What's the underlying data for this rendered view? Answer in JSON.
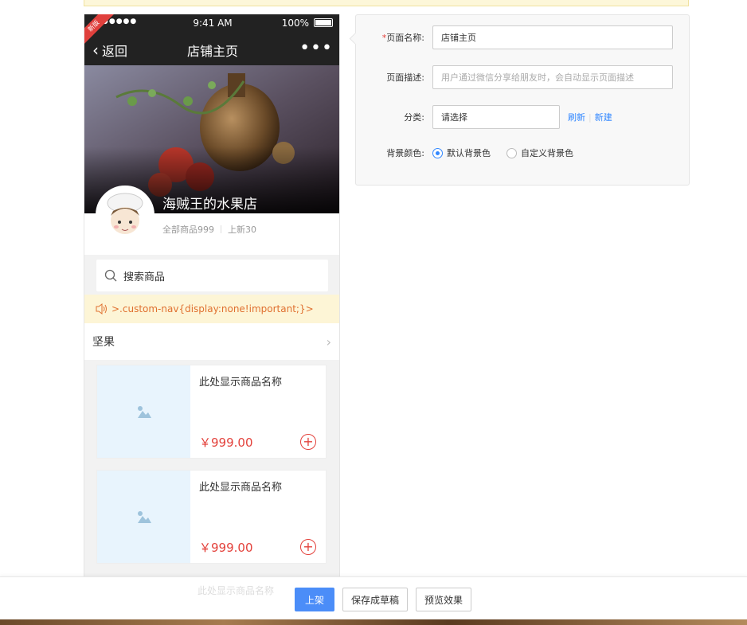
{
  "phone": {
    "status": {
      "time": "9:41 AM",
      "battery": "100%"
    },
    "ribbon": "新版",
    "nav": {
      "back": "返回",
      "title": "店铺主页",
      "more": "•••"
    },
    "shop": {
      "name": "海贼王的水果店",
      "all_goods": "全部商品999",
      "new_goods": "上新30"
    },
    "search": {
      "placeholder": "搜索商品"
    },
    "notice": ">.custom-nav{display:none!important;}>",
    "category": {
      "label": "坚果"
    },
    "products": [
      {
        "name": "此处显示商品名称",
        "price": "￥999.00"
      },
      {
        "name": "此处显示商品名称",
        "price": "￥999.00"
      }
    ]
  },
  "form": {
    "page_name": {
      "label": "页面名称:",
      "value": "店铺主页"
    },
    "page_desc": {
      "label": "页面描述:",
      "placeholder": "用户通过微信分享给朋友时，会自动显示页面描述"
    },
    "category": {
      "label": "分类:",
      "value": "请选择",
      "refresh": "刷新",
      "create": "新建"
    },
    "bg_color": {
      "label": "背景颜色:",
      "option_default": "默认背景色",
      "option_custom": "自定义背景色",
      "selected": "默认背景色"
    }
  },
  "actions": {
    "ghost_text": "此处显示商品名称",
    "publish": "上架",
    "save_draft": "保存成草稿",
    "preview": "预览效果"
  },
  "colors": {
    "accent": "#4b8df8",
    "price": "#e3413b",
    "link": "#3388ff",
    "notice_bg": "#fdf5d6"
  }
}
